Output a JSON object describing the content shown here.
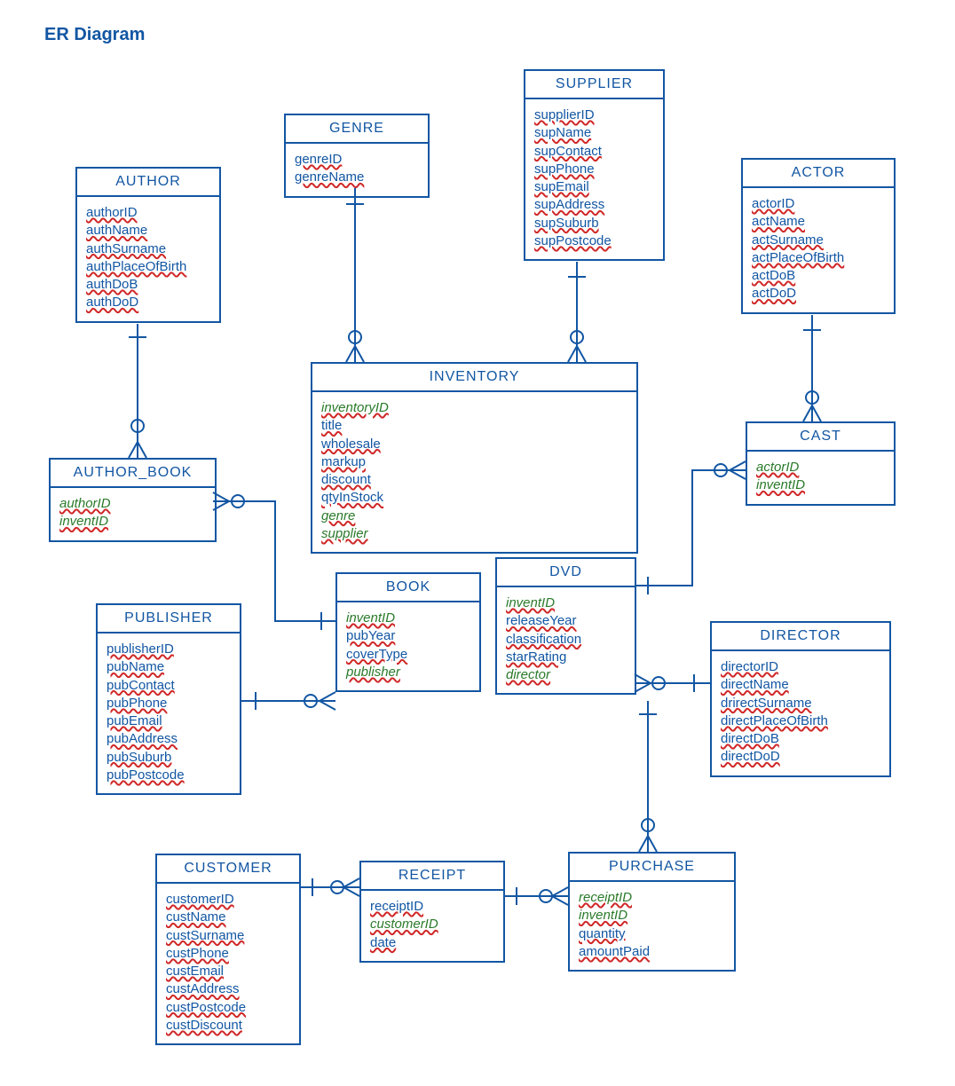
{
  "title": "ER Diagram",
  "entities": {
    "author": {
      "name": "AUTHOR",
      "attrs": [
        "authorID",
        "authName",
        "authSurname",
        "authPlaceOfBirth",
        "authDoB",
        "authDoD"
      ]
    },
    "genre": {
      "name": "GENRE",
      "attrs": [
        "genreID",
        "genreName"
      ]
    },
    "supplier": {
      "name": "SUPPLIER",
      "attrs": [
        "supplierID",
        "supName",
        "supContact",
        "supPhone",
        "supEmail",
        "supAddress",
        "supSuburb",
        "supPostcode"
      ]
    },
    "actor": {
      "name": "ACTOR",
      "attrs": [
        "actorID",
        "actName",
        "actSurname",
        "actPlaceOfBirth",
        "actDoB",
        "actDoD"
      ]
    },
    "author_book": {
      "name": "AUTHOR_BOOK",
      "attrs": [
        "authorID",
        "inventID"
      ],
      "fk_italic": [
        0,
        1
      ]
    },
    "inventory": {
      "name": "INVENTORY",
      "attrs": [
        "inventoryID",
        "title",
        "wholesale",
        "markup",
        "discount",
        "qtyInStock",
        "genre",
        "supplier"
      ],
      "fk_italic": [
        0,
        6,
        7
      ]
    },
    "cast": {
      "name": "CAST",
      "attrs": [
        "actorID",
        "inventID"
      ],
      "fk_italic": [
        0,
        1
      ]
    },
    "book": {
      "name": "BOOK",
      "attrs": [
        "inventID",
        "pubYear",
        "coverType",
        "publisher"
      ],
      "fk_italic": [
        0,
        3
      ]
    },
    "dvd": {
      "name": "DVD",
      "attrs": [
        "inventID",
        "releaseYear",
        "classification",
        "starRating",
        "director"
      ],
      "fk_italic": [
        0,
        4
      ]
    },
    "publisher": {
      "name": "PUBLISHER",
      "attrs": [
        "publisherID",
        "pubName",
        "pubContact",
        "pubPhone",
        "pubEmail",
        "pubAddress",
        "pubSuburb",
        "pubPostcode"
      ]
    },
    "director": {
      "name": "DIRECTOR",
      "attrs": [
        "directorID",
        "directName",
        "drirectSurname",
        "directPlaceOfBirth",
        "directDoB",
        "directDoD"
      ]
    },
    "customer": {
      "name": "CUSTOMER",
      "attrs": [
        "customerID",
        "custName",
        "custSurname",
        "custPhone",
        "custEmail",
        "custAddress",
        "custPostcode",
        "custDiscount"
      ]
    },
    "receipt": {
      "name": "RECEIPT",
      "attrs": [
        "receiptID",
        "customerID",
        "date"
      ],
      "fk_italic": [
        1
      ]
    },
    "purchase": {
      "name": "PURCHASE",
      "attrs": [
        "receiptID",
        "inventID",
        "quantity",
        "amountPaid"
      ],
      "fk_italic": [
        0,
        1
      ]
    }
  },
  "chart_data": {
    "type": "diagram",
    "title": "ER Diagram",
    "relationships": [
      {
        "from": "AUTHOR",
        "to": "AUTHOR_BOOK"
      },
      {
        "from": "AUTHOR_BOOK",
        "to": "BOOK"
      },
      {
        "from": "GENRE",
        "to": "INVENTORY"
      },
      {
        "from": "SUPPLIER",
        "to": "INVENTORY"
      },
      {
        "from": "ACTOR",
        "to": "CAST"
      },
      {
        "from": "CAST",
        "to": "DVD"
      },
      {
        "from": "INVENTORY",
        "to": "BOOK",
        "note": "subtype"
      },
      {
        "from": "INVENTORY",
        "to": "DVD",
        "note": "subtype"
      },
      {
        "from": "PUBLISHER",
        "to": "BOOK"
      },
      {
        "from": "DIRECTOR",
        "to": "DVD"
      },
      {
        "from": "CUSTOMER",
        "to": "RECEIPT"
      },
      {
        "from": "RECEIPT",
        "to": "PURCHASE"
      },
      {
        "from": "PURCHASE",
        "to": "INVENTORY"
      }
    ]
  }
}
